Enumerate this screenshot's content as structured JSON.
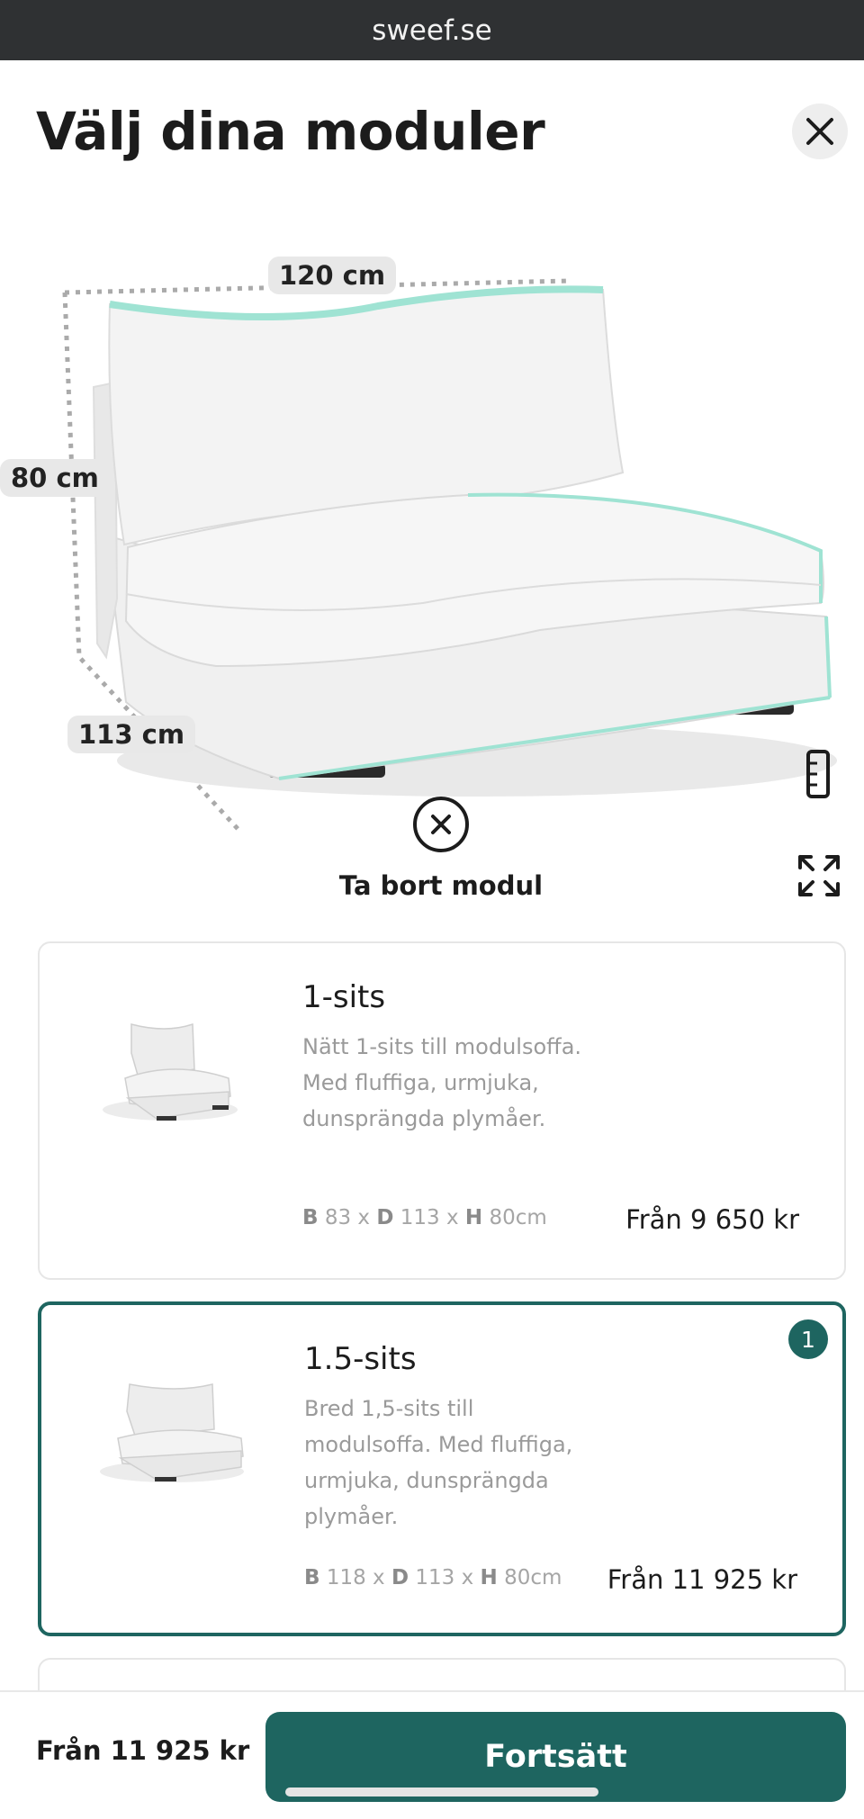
{
  "browser": {
    "url": "sweef.se"
  },
  "header": {
    "title": "Välj dina moduler",
    "close_icon": "close-icon"
  },
  "viewer": {
    "width_label": "120 cm",
    "height_label": "80 cm",
    "depth_label": "113 cm",
    "remove_label": "Ta bort modul",
    "accent_color": "#8ee0cf"
  },
  "modules": [
    {
      "name": "1-sits",
      "description": "Nätt 1-sits till modulsoffa. Med fluffiga, urmjuka, dunsprängda plymåer.",
      "dim_b": "B",
      "dim_b_val": " 83 x ",
      "dim_d": "D",
      "dim_d_val": " 113 x ",
      "dim_h": "H",
      "dim_h_val": " 80cm",
      "price": "Från 9 650 kr",
      "selected": false
    },
    {
      "name": "1.5-sits",
      "description": "Bred 1,5-sits till modulsoffa. Med fluffiga, urmjuka, dunsprängda plymåer.",
      "dim_b": "B",
      "dim_b_val": " 118 x ",
      "dim_d": "D",
      "dim_d_val": " 113 x ",
      "dim_h": "H",
      "dim_h_val": " 80cm",
      "price": "Från 11 925 kr",
      "selected": true,
      "count": "1"
    }
  ],
  "footer": {
    "total": "Från 11 925 kr",
    "continue_label": "Fortsätt",
    "brand_color": "#1e6560"
  }
}
